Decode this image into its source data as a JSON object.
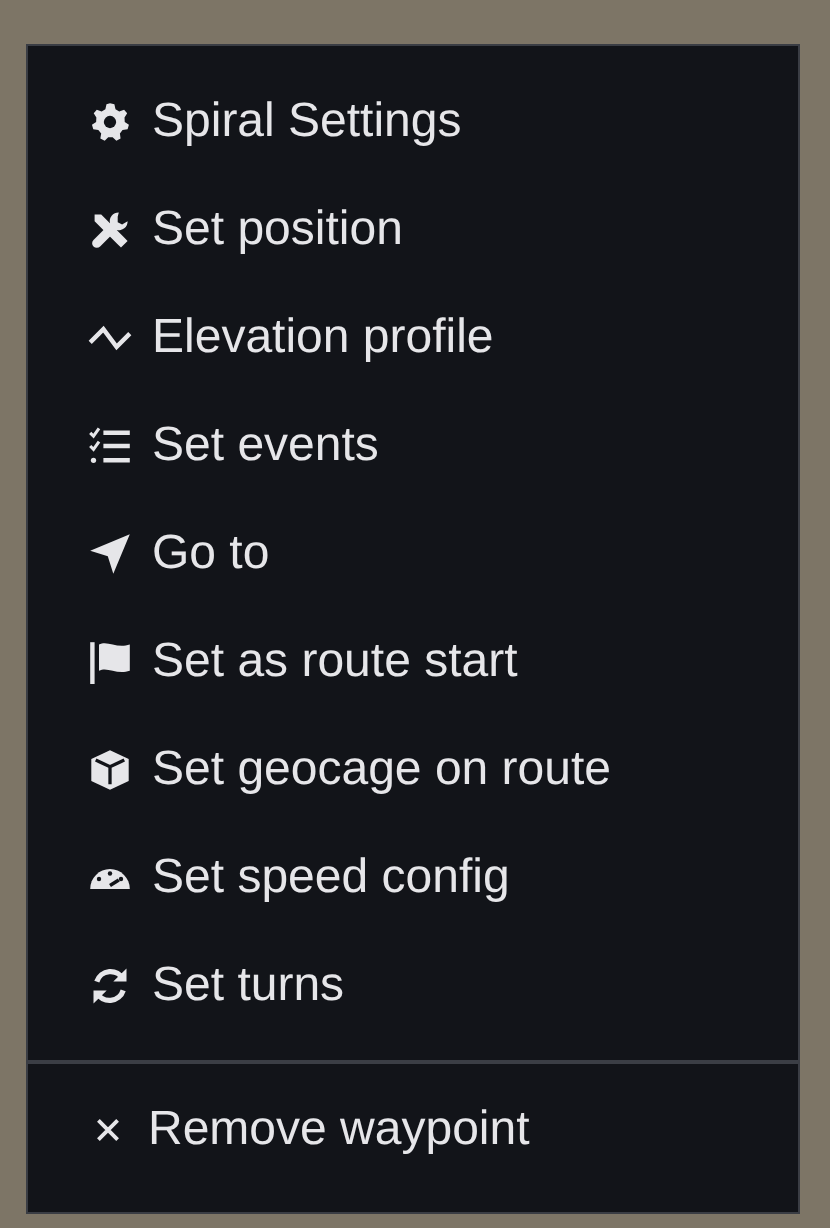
{
  "menu": {
    "items": [
      {
        "label": "Spiral Settings"
      },
      {
        "label": "Set position"
      },
      {
        "label": "Elevation profile"
      },
      {
        "label": "Set events"
      },
      {
        "label": "Go to"
      },
      {
        "label": "Set as route start"
      },
      {
        "label": "Set geocage on route"
      },
      {
        "label": "Set speed config"
      },
      {
        "label": "Set turns"
      }
    ],
    "footer_items": [
      {
        "label": "Remove waypoint"
      }
    ]
  }
}
